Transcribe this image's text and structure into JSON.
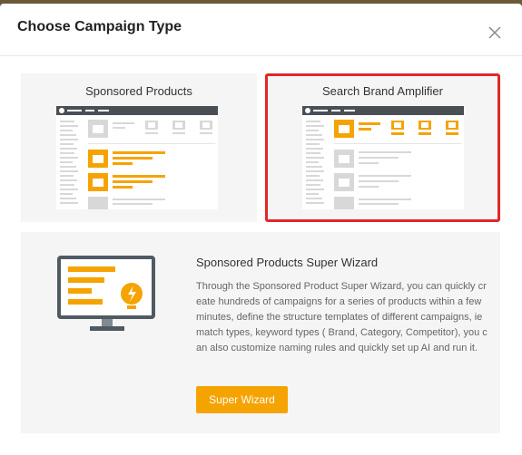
{
  "modal": {
    "title": "Choose Campaign Type",
    "close_icon": "close-icon"
  },
  "campaign_types": [
    {
      "label": "Sponsored Products",
      "selected": false
    },
    {
      "label": "Search Brand Amplifier",
      "selected": true
    }
  ],
  "wizard": {
    "title": "Sponsored Products Super Wizard",
    "description": "Through the Sponsored Product Super Wizard, you can quickly create hundreds of campaigns for a series of products within a few minutes, define the structure templates of different campaigns, ie match types, keyword types ( Brand, Category, Competitor), you can also customize naming rules and quickly set up AI and run it.",
    "button_label": "Super Wizard",
    "illustration_icon": "monitor-lightbulb-icon"
  },
  "colors": {
    "accent": "#f5a300",
    "selected_border": "#e12727",
    "card_bg": "#f5f5f5",
    "preview_bar": "#4a4f55",
    "placeholder_gray": "#d8d8d8"
  }
}
